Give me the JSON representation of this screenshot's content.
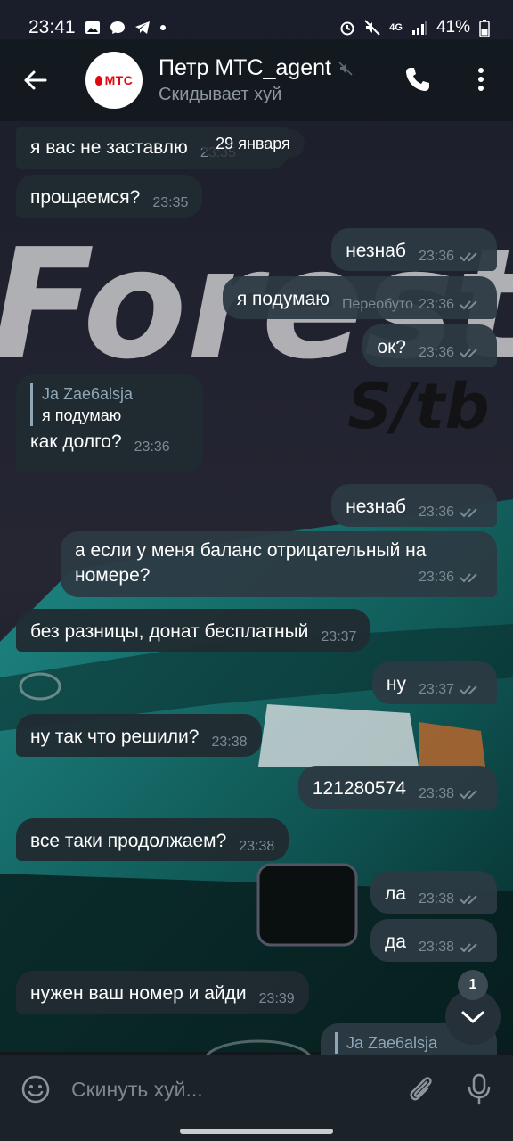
{
  "status_bar": {
    "time": "23:41",
    "network_label": "4G",
    "battery": "41%",
    "icons": [
      "gallery-icon",
      "chat-icon",
      "telegram-icon",
      "dot-icon",
      "alarm-icon",
      "mute-icon",
      "signal-icon",
      "battery-icon"
    ]
  },
  "header": {
    "avatar_text": "МТС",
    "title": "Петр МТС_agent",
    "status": "Скидывает хуй",
    "muted": true
  },
  "date_chip": "29 января",
  "messages": [
    {
      "dir": "in",
      "text": "я вас не заставлю",
      "time": "23:35",
      "partial": true
    },
    {
      "dir": "in",
      "text": "прощаемся?",
      "time": "23:35"
    },
    {
      "dir": "out",
      "text": "незнаб",
      "time": "23:36",
      "read": true
    },
    {
      "dir": "out",
      "text": "я подумаю",
      "edited": "Переобуто",
      "time": "23:36",
      "read": true
    },
    {
      "dir": "out",
      "text": "ок?",
      "time": "23:36",
      "read": true
    },
    {
      "dir": "in",
      "reply_name": "Ja Zae6alsja",
      "reply_text": "я подумаю",
      "text": "как долго?",
      "time": "23:36"
    },
    {
      "dir": "out",
      "text": "незнаб",
      "time": "23:36",
      "read": true
    },
    {
      "dir": "out",
      "text": "а если у меня баланс отрицательный на номере?",
      "time": "23:36",
      "read": true
    },
    {
      "dir": "in",
      "text": "без разницы, донат бесплатный",
      "time": "23:37"
    },
    {
      "dir": "out",
      "text": "ну",
      "time": "23:37",
      "read": true
    },
    {
      "dir": "in",
      "text": "ну так что решили?",
      "time": "23:38"
    },
    {
      "dir": "out",
      "text": "121280574",
      "time": "23:38",
      "read": true
    },
    {
      "dir": "in",
      "text": "все таки продолжаем?",
      "time": "23:38"
    },
    {
      "dir": "out",
      "text": "ла",
      "time": "23:38",
      "read": true
    },
    {
      "dir": "out",
      "text": "да",
      "time": "23:38",
      "read": true
    },
    {
      "dir": "in",
      "text": "нужен ваш номер и айди",
      "time": "23:39"
    },
    {
      "dir": "out",
      "reply_name": "Ja Zae6alsja",
      "partial": true
    }
  ],
  "unread_count": "1",
  "composer": {
    "placeholder": "Скинуть хуй..."
  },
  "colors": {
    "bubble_in": "#212b32",
    "bubble_out": "#2c3a43",
    "accent": "#8fa6b6",
    "mts_red": "#e30611"
  }
}
